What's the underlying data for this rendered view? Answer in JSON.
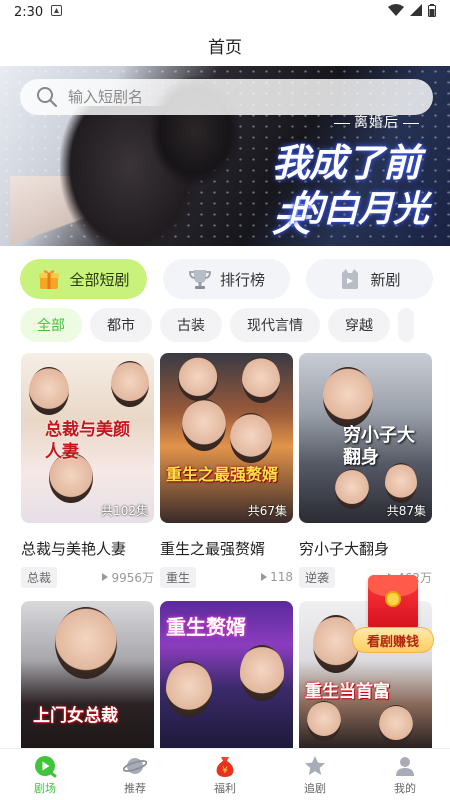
{
  "status_bar": {
    "time": "2:30"
  },
  "header": {
    "title": "首页"
  },
  "search": {
    "placeholder": "输入短剧名"
  },
  "banner": {
    "subtitle": "离婚后",
    "title_line1": "我成了前夫",
    "title_line2": "的白月光"
  },
  "categories": [
    {
      "label": "全部短剧",
      "icon": "gift-box-icon",
      "active": true
    },
    {
      "label": "排行榜",
      "icon": "trophy-icon",
      "active": false
    },
    {
      "label": "新剧",
      "icon": "new-badge-icon",
      "active": false
    }
  ],
  "tags": [
    {
      "label": "全部",
      "active": true
    },
    {
      "label": "都市",
      "active": false
    },
    {
      "label": "古装",
      "active": false
    },
    {
      "label": "现代言情",
      "active": false
    },
    {
      "label": "穿越",
      "active": false
    }
  ],
  "dramas": [
    {
      "title": "总裁与美艳人妻",
      "poster_text": "总裁与美颜人妻",
      "episodes": "共102集",
      "tag": "总裁",
      "plays": "9956万"
    },
    {
      "title": "重生之最强赘婿",
      "poster_text": "重生之最强赘婿",
      "episodes": "共67集",
      "tag": "重生",
      "plays": "118"
    },
    {
      "title": "穷小子大翻身",
      "poster_text": "穷小子大翻身",
      "episodes": "共87集",
      "tag": "逆袭",
      "plays": "462万"
    },
    {
      "title": "",
      "poster_text": "上门女总裁",
      "episodes": "",
      "tag": "",
      "plays": ""
    },
    {
      "title": "",
      "poster_text": "重生赘婿",
      "episodes": "",
      "tag": "",
      "plays": ""
    },
    {
      "title": "",
      "poster_text": "重生当首富",
      "episodes": "",
      "tag": "",
      "plays": ""
    }
  ],
  "red_envelope": {
    "label": "看剧赚钱"
  },
  "bottom_nav": [
    {
      "label": "剧场",
      "icon": "theater-play-icon",
      "active": true
    },
    {
      "label": "推荐",
      "icon": "planet-icon",
      "active": false
    },
    {
      "label": "福利",
      "icon": "money-bag-icon",
      "active": false
    },
    {
      "label": "追剧",
      "icon": "star-icon",
      "active": false
    },
    {
      "label": "我的",
      "icon": "person-icon",
      "active": false
    }
  ],
  "colors": {
    "accent_green": "#3fc43a",
    "active_card_bg": "#c9f27c",
    "red": "#d40f1f"
  }
}
